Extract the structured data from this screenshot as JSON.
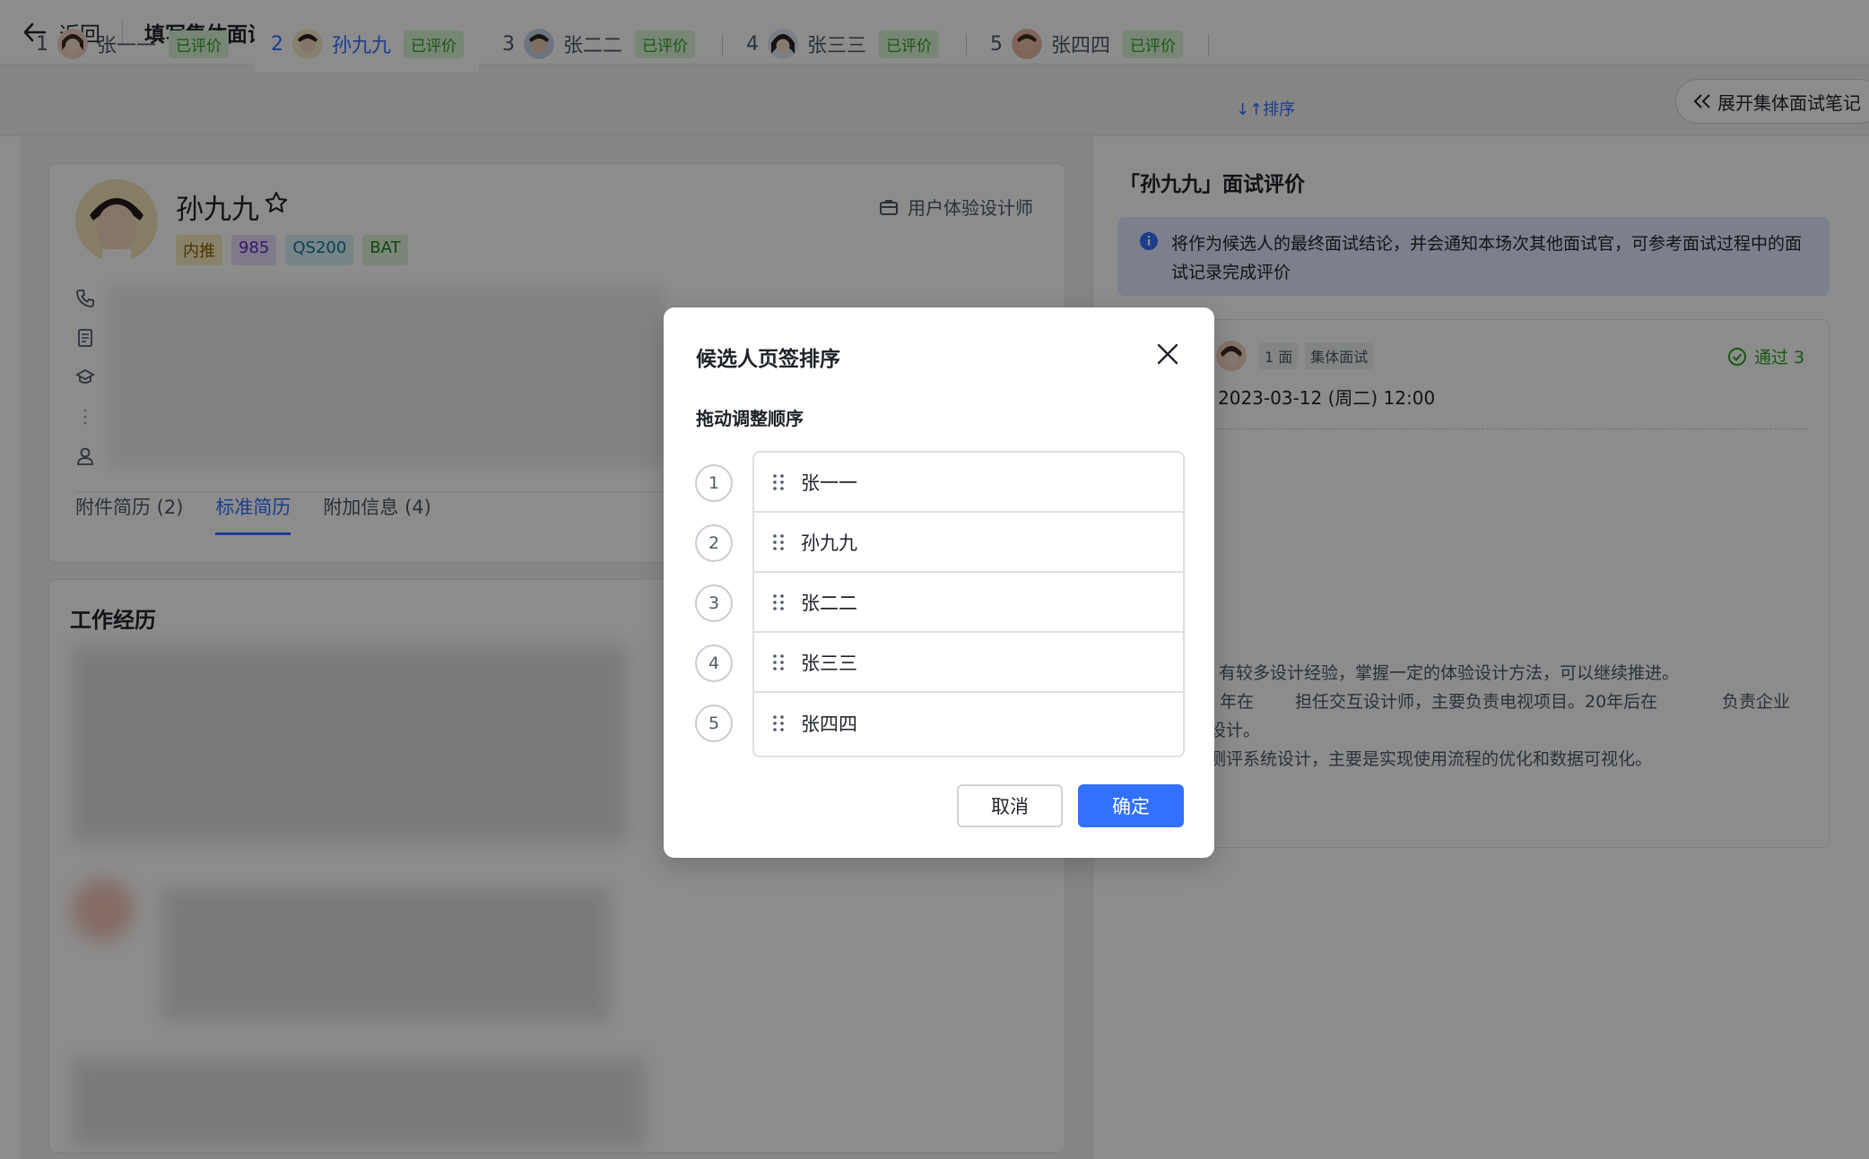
{
  "header": {
    "back_label": "返回",
    "title": "填写集体面试评价"
  },
  "candidate_tabs": [
    {
      "index": "1",
      "name": "张一一",
      "status": "已评价"
    },
    {
      "index": "2",
      "name": "孙九九",
      "status": "已评价"
    },
    {
      "index": "3",
      "name": "张二二",
      "status": "已评价"
    },
    {
      "index": "4",
      "name": "张三三",
      "status": "已评价"
    },
    {
      "index": "5",
      "name": "张四四",
      "status": "已评价"
    }
  ],
  "sort_link": "↓↑排序",
  "expand_notes": "展开集体面试笔记",
  "candidate": {
    "name": "孙九九",
    "tags": [
      "内推",
      "985",
      "QS200",
      "BAT"
    ],
    "position": "用户体验设计师"
  },
  "resume_tabs": [
    "附件简历 (2)",
    "标准简历",
    "附加信息 (4)"
  ],
  "work_title": "工作经历",
  "evaluation": {
    "title": "「孙九九」面试评价",
    "notice": "将作为候选人的最终面试结论，并会通知本场次其他面试官，可参考面试过程中的面试记录完成评价",
    "record_round": "1 面",
    "record_type": "集体面试",
    "record_result": "通过 3",
    "record_date": "2023-03-12 (周二) 12:00",
    "comment_lines": [
      "：有较多设计经验，掌握一定的体验设计方法，可以继续推进。",
      "年在",
      "担任交互设计师，主要负责电视项目。20年后在",
      "负责企业",
      "设计。",
      "测评系统设计，主要是实现使用流程的优化和数据可视化。"
    ]
  },
  "modal": {
    "title": "候选人页签排序",
    "subtitle": "拖动调整顺序",
    "items": [
      {
        "num": "1",
        "name": "张一一"
      },
      {
        "num": "2",
        "name": "孙九九"
      },
      {
        "num": "3",
        "name": "张二二"
      },
      {
        "num": "4",
        "name": "张三三"
      },
      {
        "num": "5",
        "name": "张四四"
      }
    ],
    "cancel": "取消",
    "confirm": "确定"
  },
  "colors": {
    "accent": "#3370ff",
    "success": "#2ea121",
    "mask": "rgba(0,0,0,0.45)"
  }
}
